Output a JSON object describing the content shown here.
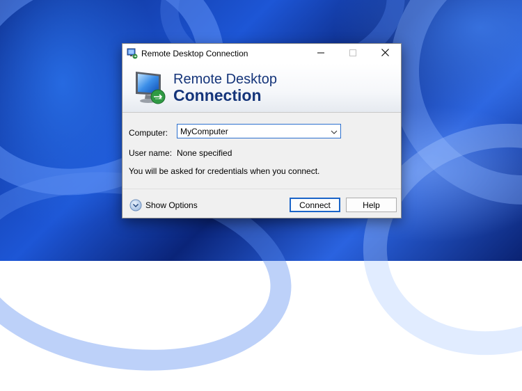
{
  "window": {
    "title": "Remote Desktop Connection",
    "controls": {
      "minimize": "minimize-icon",
      "maximize": "maximize-icon",
      "close": "close-icon"
    }
  },
  "banner": {
    "line1": "Remote Desktop",
    "line2": "Connection",
    "icon": "monitor-arrows-icon"
  },
  "form": {
    "computer_label": "Computer:",
    "computer_value": "MyComputer",
    "username_label": "User name:",
    "username_value": "None specified",
    "note": "You will be asked for credentials when you connect."
  },
  "footer": {
    "show_options_label": "Show Options",
    "connect_label": "Connect",
    "help_label": "Help"
  },
  "colors": {
    "banner_text": "#15357a",
    "focus_border": "#2b6fce"
  }
}
